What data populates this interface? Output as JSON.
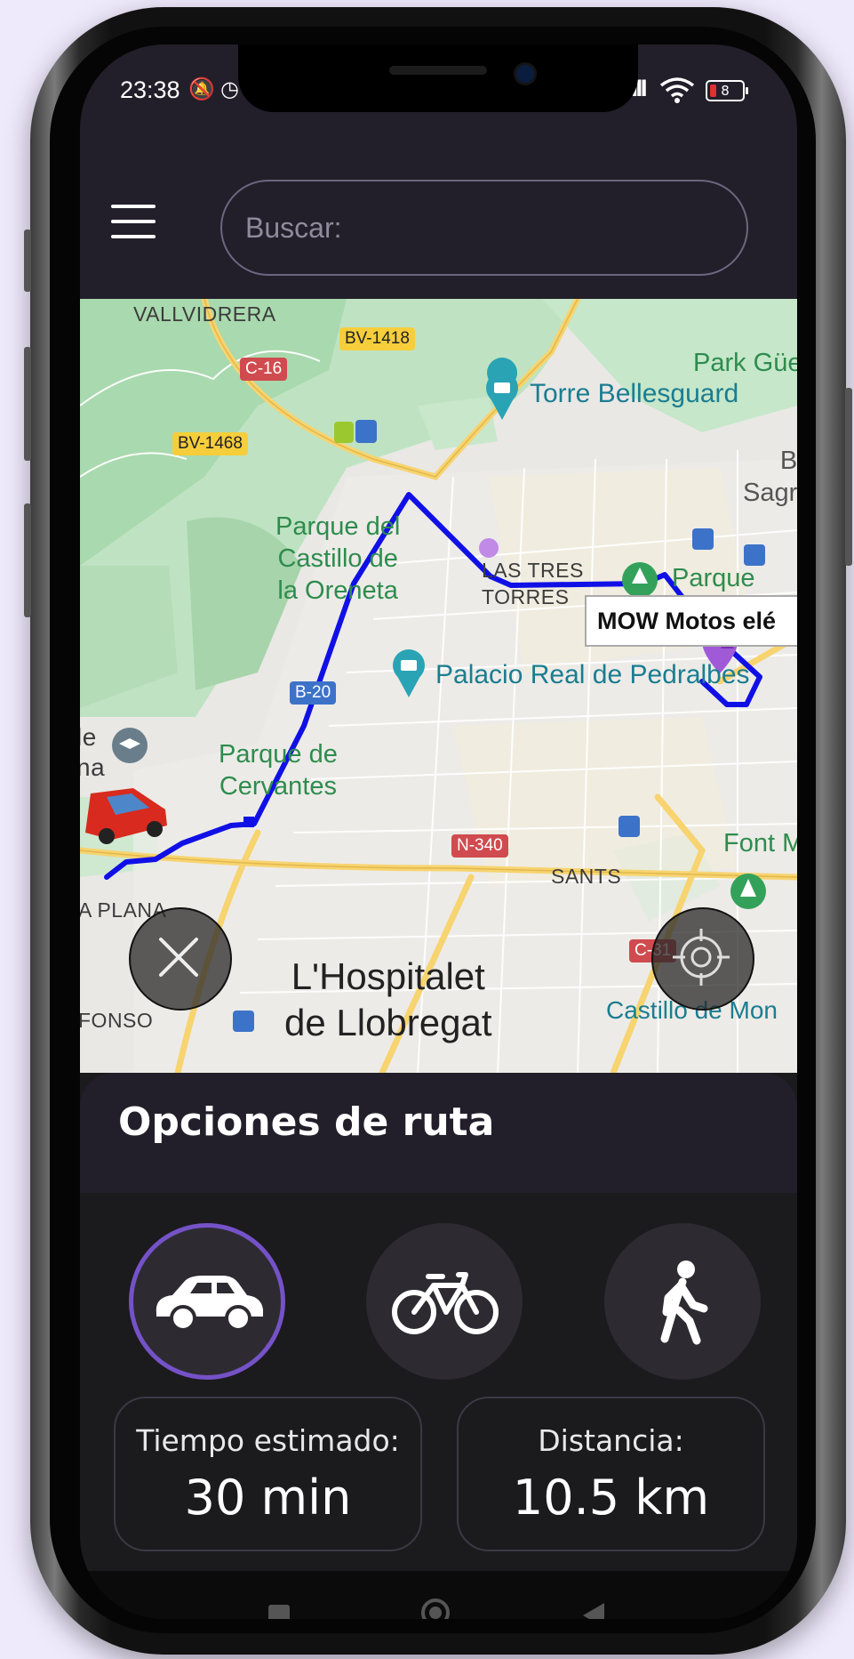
{
  "status_bar": {
    "time": "23:38",
    "battery_level": "8",
    "icons": [
      "mute-notifications-icon",
      "alarm-icon",
      "signal-icon",
      "wifi-icon",
      "battery-icon"
    ]
  },
  "header": {
    "menu_icon": "hamburger-icon",
    "search_placeholder": "Buscar:"
  },
  "map": {
    "labels": {
      "vallvidrera": "VALLVIDRERA",
      "bv1418": "BV-1418",
      "c16": "C-16",
      "bv1468": "BV-1468",
      "park_guell": "Park Güe",
      "torre_bellesguard": "Torre Bellesguard",
      "b_sagr": "B\nSagr",
      "parque_castillo": "Parque del\nCastillo de\nla Oreneta",
      "las_tres_torres": "LAS TRES\nTORRES",
      "parque": "Parque",
      "palacio_real": "Palacio Real de Pedralbes",
      "b20": "B-20",
      "le_na": "le\nna",
      "parque_cervantes": "Parque de\nCervantes",
      "n340": "N-340",
      "sants": "SANTS",
      "font_m": "Font M",
      "a_plana": "A PLANA",
      "c31": "C-31",
      "hospitalet": "L'Hospitalet\nde Llobregat",
      "fonso": "FONSO",
      "castillo_mon": "Castillo de Mon"
    },
    "popup_text": "MOW Motos elé",
    "colors": {
      "route": "#1010e6",
      "destination_pin": "#a05ad8",
      "car": "#d82a1e"
    }
  },
  "route_panel": {
    "title": "Opciones de ruta",
    "modes": [
      {
        "name": "car",
        "icon": "car-icon",
        "selected": true
      },
      {
        "name": "bike",
        "icon": "bike-icon",
        "selected": false
      },
      {
        "name": "walk",
        "icon": "walk-icon",
        "selected": false
      }
    ],
    "estimated_time_label": "Tiempo estimado:",
    "estimated_time_value": "30 min",
    "distance_label": "Distancia:",
    "distance_value": "10.5 km",
    "accent_color": "#7552c8"
  },
  "nav_bar": {
    "buttons": [
      "recents-square-icon",
      "home-circle-icon",
      "back-triangle-icon"
    ]
  }
}
